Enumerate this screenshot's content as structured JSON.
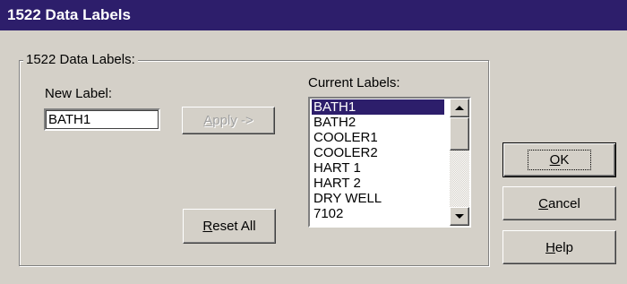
{
  "window": {
    "title": "1522 Data Labels"
  },
  "group": {
    "legend": "1522 Data Labels:"
  },
  "new_label": {
    "caption": "New Label:",
    "value": "BATH1"
  },
  "apply": {
    "mnemonic": "A",
    "rest": "pply ->"
  },
  "reset_all": {
    "mnemonic": "R",
    "rest": "eset All"
  },
  "current_labels": {
    "caption": "Current Labels:",
    "items": [
      "BATH1",
      "BATH2",
      "COOLER1",
      "COOLER2",
      "HART 1",
      "HART 2",
      "DRY WELL",
      "7102"
    ],
    "selected_index": 0
  },
  "buttons": {
    "ok": {
      "mnemonic": "O",
      "rest": "K"
    },
    "cancel": {
      "mnemonic": "C",
      "rest": "ancel"
    },
    "help": {
      "mnemonic": "H",
      "rest": "elp"
    }
  },
  "colors": {
    "titlebar": "#2d1e6b",
    "selection": "#2d1e6b",
    "face": "#d4d0c8"
  }
}
